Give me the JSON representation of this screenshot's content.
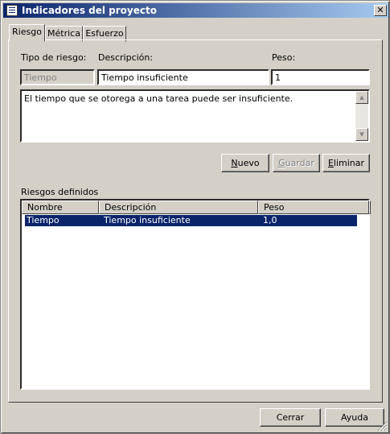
{
  "window": {
    "title": "Indicadores del proyecto",
    "close_glyph": "✕"
  },
  "tabs": [
    {
      "label": "Riesgo",
      "active": true
    },
    {
      "label": "Métrica",
      "active": false
    },
    {
      "label": "Esfuerzo",
      "active": false
    }
  ],
  "form": {
    "tipo_label": "Tipo de riesgo:",
    "descripcion_label": "Descripción:",
    "peso_label": "Peso:",
    "tipo_value": "Tiempo",
    "descripcion_value": "Tiempo insuficiente",
    "peso_value": "1",
    "detail_text": "El tiempo que se otorega a una tarea puede ser insuficiente."
  },
  "buttons": {
    "nuevo": {
      "underline": "N",
      "rest": "uevo"
    },
    "guardar": {
      "underline": "G",
      "rest": "uardar"
    },
    "eliminar": {
      "underline": "E",
      "rest": "liminar"
    }
  },
  "riesgos": {
    "title": "Riesgos definidos",
    "columns": [
      "Nombre",
      "Descripción",
      "Peso"
    ],
    "rows": [
      {
        "nombre": "Tiempo",
        "descripcion": "Tiempo insuficiente",
        "peso": "1,0",
        "selected": true
      }
    ]
  },
  "footer": {
    "cerrar": "Cerrar",
    "ayuda": "Ayuda"
  },
  "icons": {
    "scroll_up": "▲",
    "scroll_down": "▼"
  },
  "colors": {
    "titlebar": "#0a246a",
    "selection": "#0a246a",
    "face": "#d4d0c8"
  }
}
